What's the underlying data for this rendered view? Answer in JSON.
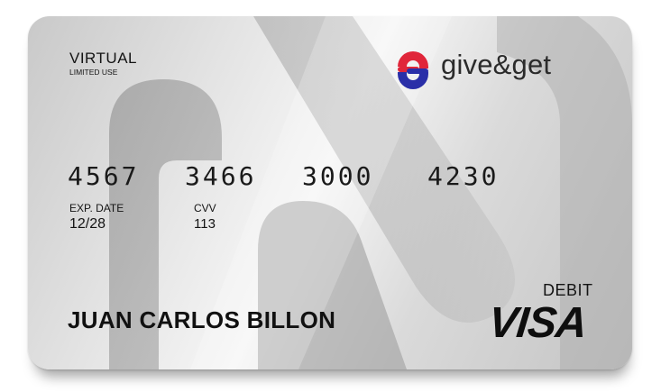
{
  "card": {
    "type_label": "VIRTUAL",
    "usage_label": "LIMITED USE",
    "brand_name": "give&get",
    "number_groups": [
      "4567",
      "3466",
      "3000",
      "4230"
    ],
    "exp_label": "EXP. DATE",
    "exp_value": "12/28",
    "cvv_label": "CVV",
    "cvv_value": "113",
    "holder_name": "JUAN CARLOS BILLON",
    "card_kind": "DEBIT",
    "network": "VISA"
  },
  "colors": {
    "logo_red": "#e0263a",
    "logo_blue": "#2a2fa8",
    "card_silver": "#d8d8d8",
    "text": "#141414"
  },
  "icons": {
    "brand_logo": "give-and-get-logo-icon",
    "network_logo": "visa-logo-icon"
  }
}
